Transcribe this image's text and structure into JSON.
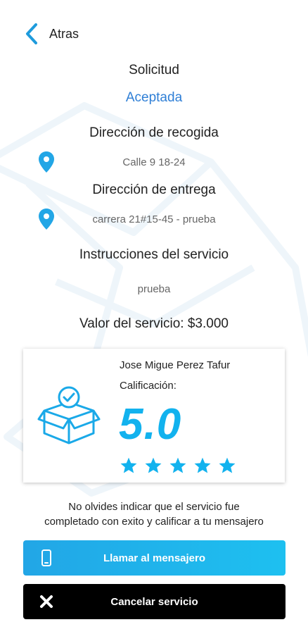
{
  "header": {
    "back_label": "Atras"
  },
  "status": {
    "title": "Solicitud",
    "value": "Aceptada"
  },
  "pickup": {
    "label": "Dirección de recogida",
    "address": "Calle 9 18-24"
  },
  "delivery": {
    "label": "Dirección de entrega",
    "address": "carrera 21#15-45 - prueba"
  },
  "instructions": {
    "label": "Instrucciones del servicio",
    "text": "prueba"
  },
  "price": {
    "text": "Valor del servicio: $3.000"
  },
  "courier": {
    "name": "Jose Migue Perez Tafur",
    "rating_label": "Calificación:",
    "rating_value": "5.0",
    "stars_filled": 5,
    "stars_total": 5
  },
  "note": {
    "line1": "No olvides indicar que el servicio fue",
    "line2": "completado con exito y calificar a tu mensajero"
  },
  "buttons": {
    "call_label": "Llamar al mensajero",
    "cancel_label": "Cancelar servicio"
  },
  "colors": {
    "accent": "#2f7fd6",
    "rating": "#12b2ee",
    "pin": "#22a6e6",
    "call_button": "#22a6e6",
    "cancel_button": "#000000"
  },
  "icons": {
    "back": "chevron-left-icon",
    "pin": "location-pin-icon",
    "box": "package-check-icon",
    "star": "star-icon",
    "phone": "phone-icon",
    "close": "close-icon"
  }
}
